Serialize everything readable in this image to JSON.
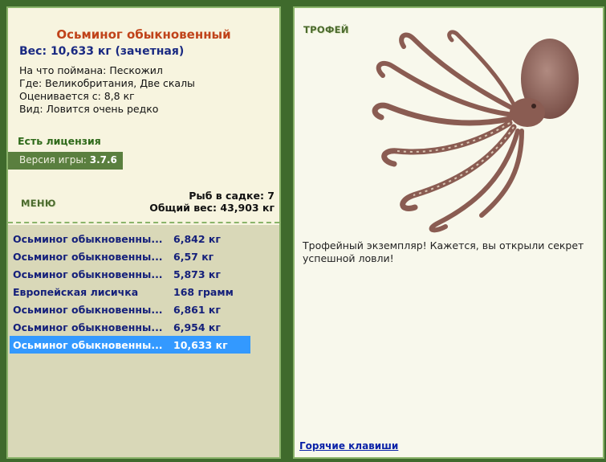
{
  "fish": {
    "title": "Осьминог обыкновенный",
    "weight_line": "Вес: 10,633 кг (зачетная)",
    "info": [
      "На что поймана: Пескожил",
      "Где: Великобритания, Две скалы",
      "Оценивается с: 8,8 кг",
      "Вид: Ловится очень редко"
    ]
  },
  "license": "Есть лицензия",
  "version": {
    "label": "Версия игры:",
    "value": "3.7.6"
  },
  "menu": "МЕНЮ",
  "stats": {
    "keepnet": "Рыб в садке: 7",
    "total": "Общий вес: 43,903 кг"
  },
  "catch_list": [
    {
      "name": "Осьминог обыкновенны...",
      "weight": "6,842 кг",
      "selected": false
    },
    {
      "name": "Осьминог обыкновенны...",
      "weight": "6,57 кг",
      "selected": false
    },
    {
      "name": "Осьминог обыкновенны...",
      "weight": "5,873 кг",
      "selected": false
    },
    {
      "name": "Европейская лисичка",
      "weight": "168 грамм",
      "selected": false
    },
    {
      "name": "Осьминог обыкновенны...",
      "weight": "6,861 кг",
      "selected": false
    },
    {
      "name": "Осьминог обыкновенны...",
      "weight": "6,954 кг",
      "selected": false
    },
    {
      "name": "Осьминог обыкновенны...",
      "weight": "10,633 кг",
      "selected": true
    }
  ],
  "trophy": {
    "label": "ТРОФЕЙ",
    "description": "Трофейный экземпляр! Кажется, вы открыли секрет успешной ловли!"
  },
  "hotkeys": "Горячие клавиши",
  "colors": {
    "frame": "#3f6a2c",
    "panel": "#f7f4df",
    "list_bg": "#d9d8b8",
    "selected": "#3399ff",
    "title": "#c0431a",
    "link": "#15207a"
  }
}
